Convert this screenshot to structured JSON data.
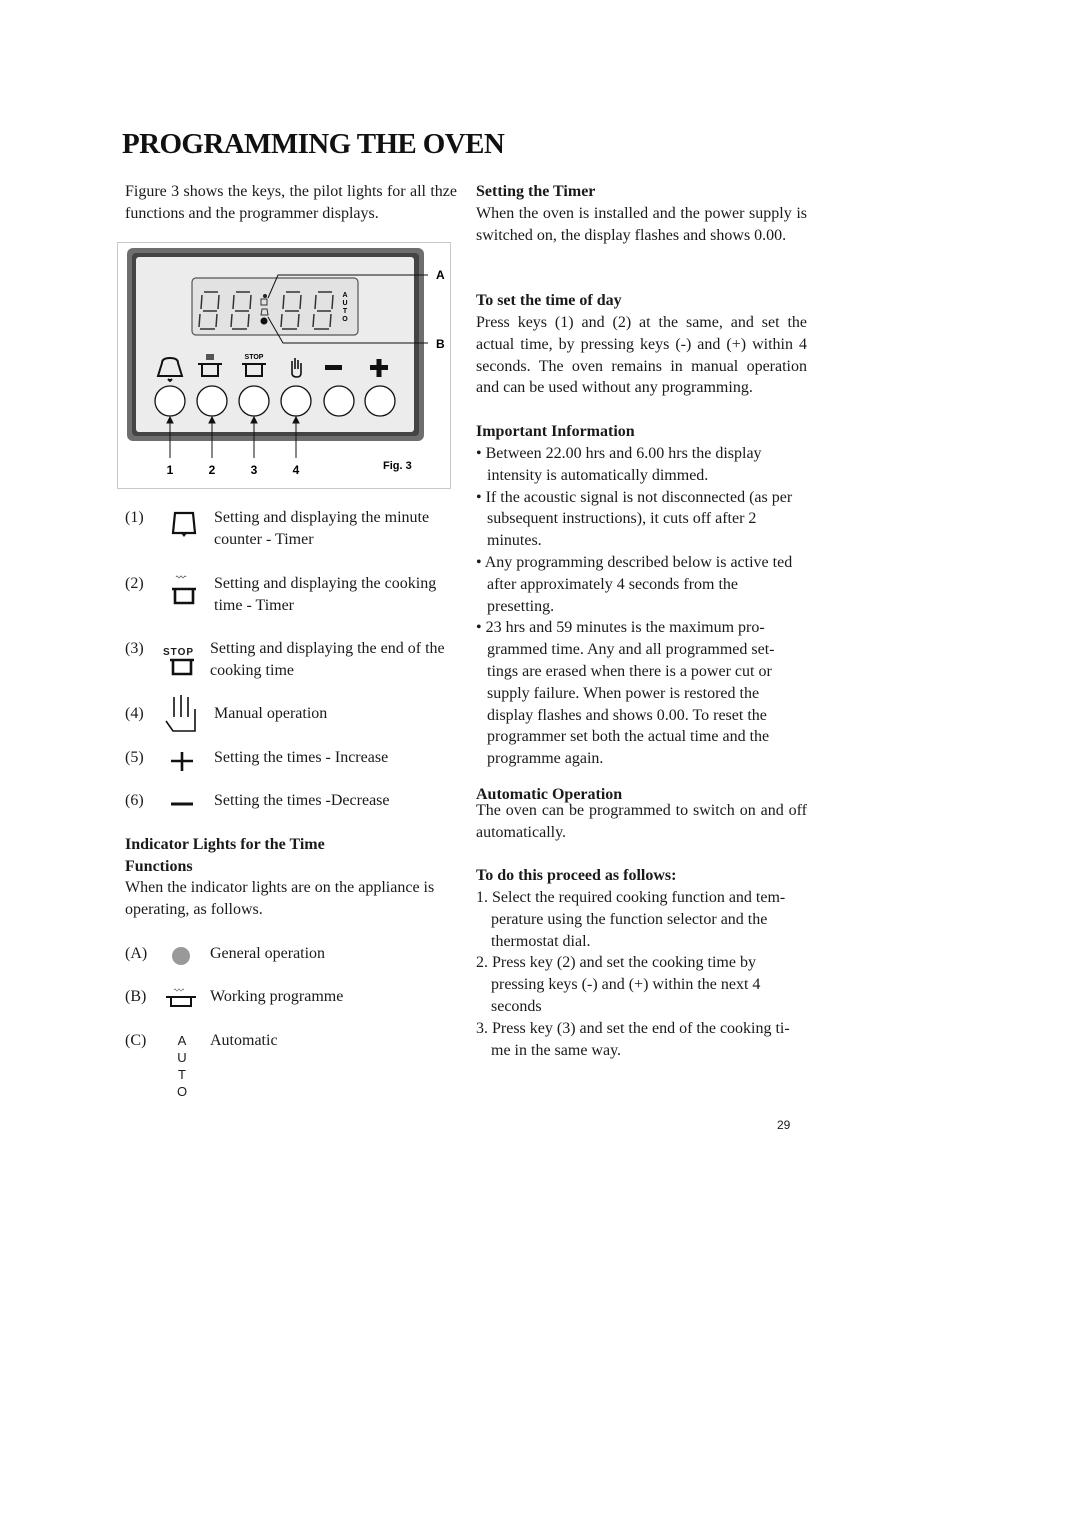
{
  "page": {
    "title": "PROGRAMMING THE OVEN",
    "intro": "Figure 3 shows the keys, the pilot lights for all thze functions and the programmer displays.",
    "page_number": "29"
  },
  "figure": {
    "caption": "Fig. 3",
    "display_label_auto": [
      "A",
      "U",
      "T",
      "O"
    ],
    "callouts": [
      "A",
      "B"
    ],
    "key_numbers": [
      "1",
      "2",
      "3",
      "4"
    ],
    "key_stop_label": "STOP",
    "keys": [
      {
        "icon": "bell-icon"
      },
      {
        "icon": "cooking-pot-icon"
      },
      {
        "icon": "stop-pot-icon"
      },
      {
        "icon": "hand-icon"
      },
      {
        "icon": "minus-icon"
      },
      {
        "icon": "plus-icon"
      }
    ]
  },
  "keys_list": [
    {
      "num": "(1)",
      "icon": "bell-icon",
      "text": "Setting and displaying the minute counter - Timer"
    },
    {
      "num": "(2)",
      "icon": "cooking-pot-icon",
      "text": "Setting and displaying the cooking time - Timer"
    },
    {
      "num": "(3)",
      "icon": "stop-pot-icon",
      "icon_label": "STOP",
      "text": "Setting and displaying the end of the cooking time"
    },
    {
      "num": "(4)",
      "icon": "hand-icon",
      "text": "Manual operation"
    },
    {
      "num": "(5)",
      "icon": "plus-icon",
      "text": "Setting the times - Increase"
    },
    {
      "num": "(6)",
      "icon": "minus-icon",
      "text": "Setting the times -Decrease"
    }
  ],
  "indicator_lights": {
    "heading_line1": "Indicator Lights for the Time",
    "heading_line2": "Functions",
    "text": "When the indicator lights are on the appliance is operating, as follows.",
    "items": [
      {
        "num": "(A)",
        "icon": "grey-dot-icon",
        "text": "General operation"
      },
      {
        "num": "(B)",
        "icon": "cooking-pot-icon",
        "text": "Working programme"
      },
      {
        "num": "(C)",
        "icon": "auto-icon",
        "icon_letters": [
          "A",
          "U",
          "T",
          "O"
        ],
        "text": "Automatic"
      }
    ]
  },
  "setting_timer": {
    "heading": "Setting the Timer",
    "text": "When the oven is installed and the power supply is switched on, the display flashes and shows 0.00."
  },
  "time_of_day": {
    "heading": "To set the time of day",
    "text": "Press keys (1) and (2) at the same, and set the actual time, by pressing keys (-) and (+) within 4 seconds. The oven remains in manual operation and can be used without any programming."
  },
  "important_info": {
    "heading": "Important Information",
    "bullets": [
      "• Between 22.00 hrs and 6.00 hrs the display intensity is automatically dimmed.",
      "• If the acoustic signal is not disconnected (as per subsequent instructions), it cuts off after 2 minutes.",
      "• Any programming described below is active ted after approximately 4 seconds from the presetting.",
      "• 23 hrs and 59 minutes is the maximum pro- grammed time. Any and all programmed set- tings are erased when there is a power cut or supply failure. When power is restored the display flashes and shows 0.00. To reset the programmer set both the actual time and the programme again."
    ]
  },
  "automatic_operation": {
    "heading": "Automatic Operation",
    "text": "The oven can be programmed to switch on and off automatically."
  },
  "proceed": {
    "heading": "To do this proceed as follows:",
    "steps": [
      "1. Select the required cooking function and tem- perature using the function selector and the thermostat dial.",
      "2. Press key (2) and set the cooking time by pressing keys (-) and (+) within the next 4 seconds",
      "3. Press key (3) and set the end of the cooking ti- me in the same way."
    ]
  },
  "colors": {
    "panel_frame": "#555555",
    "display_bg": "#e6e6e6",
    "indicator_grey": "#999999"
  }
}
